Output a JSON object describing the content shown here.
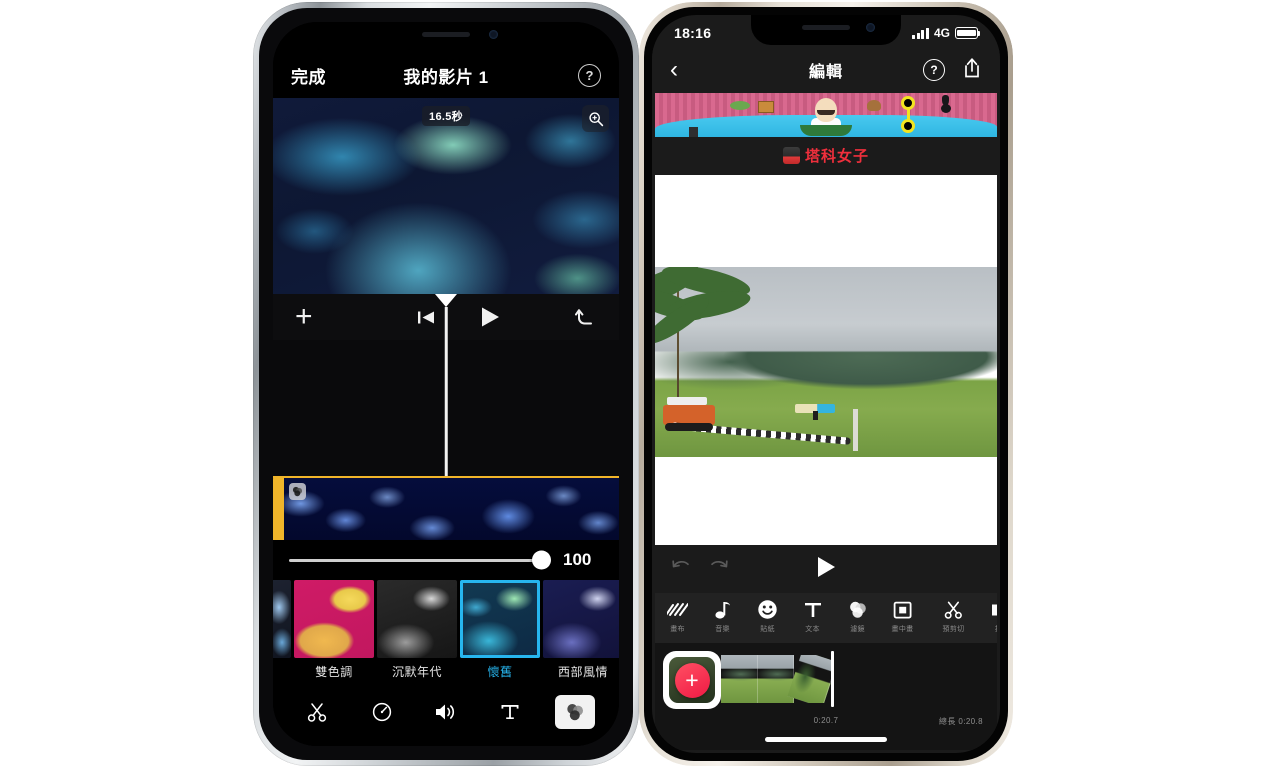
{
  "left_phone": {
    "app": "iMovie",
    "navbar": {
      "done_label": "完成",
      "title": "我的影片 1",
      "help_icon": "question-circle-icon"
    },
    "preview": {
      "timecode": "16.5秒",
      "zoom_icon": "magnifier-plus-icon"
    },
    "controls": {
      "add_icon": "plus-icon",
      "rewind_icon": "skip-to-start-icon",
      "play_icon": "play-icon",
      "undo_icon": "undo-arrow-icon"
    },
    "timeline": {
      "clip_badge_icon": "filter-badge-icon",
      "selected_clip": true
    },
    "slider": {
      "value": "100",
      "percent": 100
    },
    "filters": {
      "items": [
        {
          "label": "",
          "selected": false,
          "style": "peek"
        },
        {
          "label": "雙色調",
          "selected": false,
          "style": "duotone"
        },
        {
          "label": "沉默年代",
          "selected": false,
          "style": "silent-era"
        },
        {
          "label": "懷舊",
          "selected": true,
          "style": "vintage"
        },
        {
          "label": "西部風情",
          "selected": false,
          "style": "western"
        }
      ]
    },
    "toolbar": {
      "items": [
        {
          "icon": "scissors-icon",
          "active": false
        },
        {
          "icon": "speedometer-icon",
          "active": false
        },
        {
          "icon": "speaker-volume-icon",
          "active": false
        },
        {
          "icon": "text-t-icon",
          "active": false
        },
        {
          "icon": "color-filters-icon",
          "active": true
        }
      ]
    },
    "accent_selected": "#27b6ef",
    "accent_clip": "#f0b52a"
  },
  "right_phone": {
    "status_bar": {
      "time": "18:16",
      "signal_icon": "signal-bars-icon",
      "network": "4G",
      "battery_icon": "battery-full-icon"
    },
    "navbar": {
      "back_icon": "chevron-left-icon",
      "title": "編輯",
      "help_icon": "question-circle-icon",
      "share_icon": "share-up-arrow-icon"
    },
    "ad_banner": {
      "type": "game-ad-banner"
    },
    "brand": {
      "icon": "brand-logo-icon",
      "text": "塔科女子",
      "color": "#ef2f3c"
    },
    "canvas": {
      "content": "landscape-photo"
    },
    "playbar": {
      "undo_icon": "undo-arrow-icon",
      "redo_icon": "redo-arrow-icon",
      "play_icon": "play-icon"
    },
    "tools": [
      {
        "label": "畫布",
        "icon": "hatch-lines-icon"
      },
      {
        "label": "音樂",
        "icon": "music-note-icon"
      },
      {
        "label": "貼紙",
        "icon": "smiley-face-icon"
      },
      {
        "label": "文本",
        "icon": "text-t-icon"
      },
      {
        "label": "濾鏡",
        "icon": "color-filters-icon"
      },
      {
        "label": "畫中畫",
        "icon": "picture-in-picture-icon"
      },
      {
        "label": "預剪切",
        "icon": "scissors-icon"
      },
      {
        "label": "拆",
        "icon": "split-clip-icon"
      }
    ],
    "timeline": {
      "add_icon": "plus-icon",
      "add_color": "#f01a44",
      "current_time": "0:20.7",
      "total_time": "總長 0:20.8"
    }
  }
}
